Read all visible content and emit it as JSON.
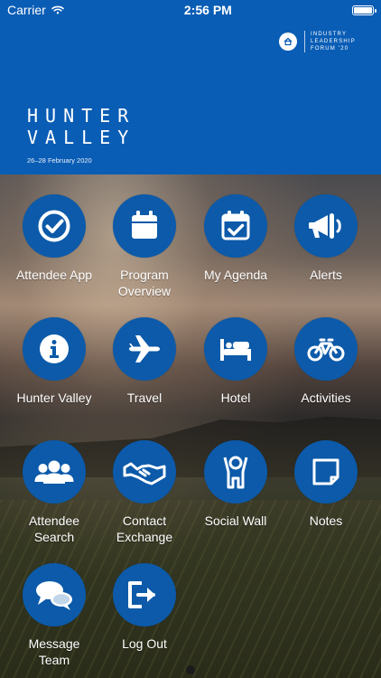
{
  "status_bar": {
    "carrier": "Carrier",
    "time": "2:56 PM"
  },
  "header": {
    "logo_text_line1": "INDUSTRY",
    "logo_text_line2": "LEADERSHIP",
    "logo_text_line3": "FORUM '20",
    "title_line1": "HUNTER",
    "title_line2": "VALLEY",
    "date_text": "26–28 February 2020"
  },
  "menu": {
    "items": [
      {
        "label": "Attendee App",
        "icon": "checkmark-icon"
      },
      {
        "label": "Program Overview",
        "icon": "calendar-icon"
      },
      {
        "label": "My Agenda",
        "icon": "calendar-check-icon"
      },
      {
        "label": "Alerts",
        "icon": "megaphone-icon"
      },
      {
        "label": "Hunter Valley",
        "icon": "info-icon"
      },
      {
        "label": "Travel",
        "icon": "airplane-icon"
      },
      {
        "label": "Hotel",
        "icon": "bed-icon"
      },
      {
        "label": "Activities",
        "icon": "bicycle-icon"
      },
      {
        "label": "Attendee Search",
        "icon": "people-icon"
      },
      {
        "label": "Contact Exchange",
        "icon": "handshake-icon"
      },
      {
        "label": "Social Wall",
        "icon": "person-icon"
      },
      {
        "label": "Notes",
        "icon": "note-icon"
      },
      {
        "label": "Message Team",
        "icon": "chat-icon"
      },
      {
        "label": "Log Out",
        "icon": "logout-icon"
      }
    ]
  }
}
